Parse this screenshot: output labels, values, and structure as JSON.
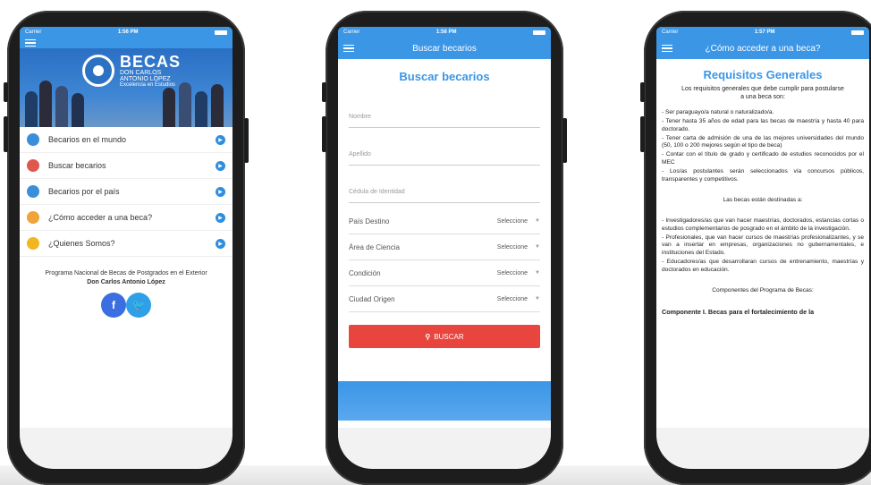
{
  "phone1": {
    "carrier": "Carrier",
    "time": "1:56 PM",
    "hero": {
      "brand": "BECAS",
      "line2": "DON CARLOS",
      "line3": "ANTONIO LÓPEZ",
      "tagline": "Excelencia en Estudios"
    },
    "menu": [
      {
        "label": "Becarios en el mundo",
        "icon": "globe-icon",
        "color": "#3b8fd8"
      },
      {
        "label": "Buscar becarios",
        "icon": "search-people-icon",
        "color": "#e0574e"
      },
      {
        "label": "Becarios por el país",
        "icon": "people-icon",
        "color": "#3b8fd8"
      },
      {
        "label": "¿Cómo acceder a una beca?",
        "icon": "question-icon",
        "color": "#f0a33a"
      },
      {
        "label": "¿Quienes Somos?",
        "icon": "info-icon",
        "color": "#f2b623"
      }
    ],
    "footer_line1": "Programa Nacional de Becas de Postgrados en el Exterior",
    "footer_line2": "Don Carlos Antonio López",
    "social": {
      "facebook": "f",
      "twitter": "🐦",
      "facebook_color": "#3b6ee0",
      "twitter_color": "#2fa0e8"
    }
  },
  "phone2": {
    "carrier": "Carrier",
    "time": "1:56 PM",
    "nav_title": "Buscar becarios",
    "heading": "Buscar becarios",
    "fields": {
      "nombre": "Nombre",
      "apellido": "Apellido",
      "cedula": "Cédula de Identidad"
    },
    "selects": [
      {
        "label": "País Destino",
        "value": "Seleccione"
      },
      {
        "label": "Área de Ciencia",
        "value": "Seleccione"
      },
      {
        "label": "Condición",
        "value": "Seleccione"
      },
      {
        "label": "Ciudad Origen",
        "value": "Seleccione"
      }
    ],
    "button": "BUSCAR"
  },
  "phone3": {
    "carrier": "Carrier",
    "time": "1:57 PM",
    "nav_title": "¿Cómo acceder a una beca?",
    "heading": "Requisitos Generales",
    "intro": "Los requisitos generales que debe cumplir para postularse a una beca son:",
    "requirements": [
      "- Ser paraguayo/a natural o naturalizado/a.",
      "- Tener hasta 35 años de edad para las becas de maestría y hasta 40 para doctorado.",
      "- Tener carta de admisión de una de las mejores universidades del mundo (50, 100 o 200 mejores según el tipo de beca)",
      "- Contar con el título de grado y certificado de estudios reconocidos por el MEC",
      "- Los/as postulantes serán seleccionados vía concursos públicos, transparentes y competitivos."
    ],
    "destined_title": "Las becas están destinadas a:",
    "destined": [
      "- Investigadores/as que van hacer maestrías, doctorados, estancias cortas o estudios complementarios de posgrado en el ámbito de la investigación.",
      "- Profesionales, que van hacer cursos de maestrías profesionalizantes, y se van a insertar en empresas, organizaciones no gubernamentales, e instituciones del Estado.",
      "- Educadores/as que desarrollaran cursos de entrenamiento, maestrías y doctorados en educación."
    ],
    "components_title": "Componentes del Programa de Becas:",
    "component1": "Componente I. Becas para el fortalecimiento de la"
  }
}
